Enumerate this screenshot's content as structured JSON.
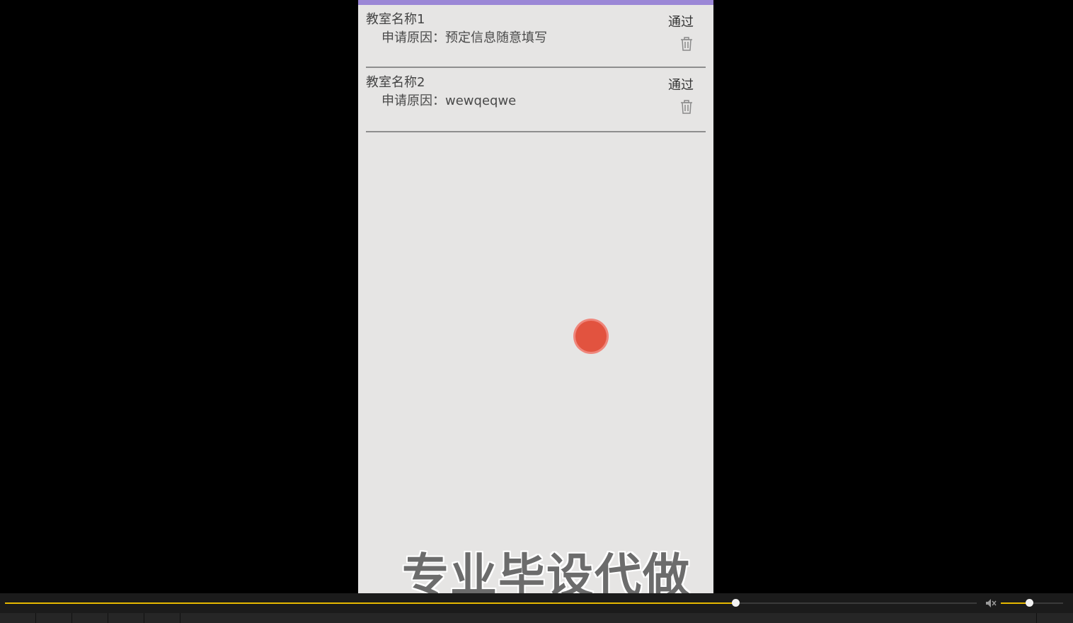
{
  "requests": [
    {
      "room_name": "教室名称1",
      "reason": "申请原因：预定信息随意填写",
      "approve_label": "通过"
    },
    {
      "room_name": "教室名称2",
      "reason": "申请原因：wewqeqwe",
      "approve_label": "通过"
    }
  ],
  "watermark": "专业毕设代做",
  "player": {
    "progress": 0.752,
    "volume": 0.45
  },
  "colors": {
    "header_accent": "#9b87d6",
    "app_background": "#e6e5e4",
    "touch_indicator": "#e2533f",
    "progress_fill": "#e6b800"
  },
  "icons": {
    "delete": "trash-icon",
    "mute": "speaker-mute-icon"
  }
}
